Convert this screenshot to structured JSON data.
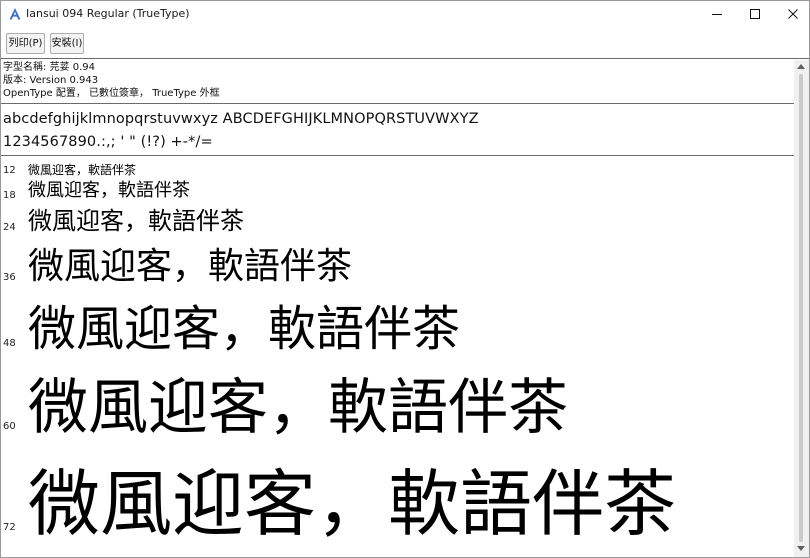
{
  "window": {
    "title": "Iansui 094 Regular (TrueType)",
    "controls": {
      "minimize": "minimize",
      "maximize": "maximize",
      "close": "close"
    }
  },
  "toolbar": {
    "print_label": "列印(P)",
    "install_label": "安裝(I)"
  },
  "font_info": {
    "name_line": "字型名稱: 芫荽 0.94",
    "version_line": "版本: Version 0.943",
    "features_line": "OpenType 配置， 已數位簽章， TrueType 外框"
  },
  "charset": {
    "alphabet": "abcdefghijklmnopqrstuvwxyz ABCDEFGHIJKLMNOPQRSTUVWXYZ",
    "digits_symbols": "1234567890.:,; ' \" (!?) +-*/="
  },
  "samples": [
    {
      "size_label": "12",
      "text": "微風迎客，軟語伴茶"
    },
    {
      "size_label": "18",
      "text": "微風迎客，軟語伴茶"
    },
    {
      "size_label": "24",
      "text": "微風迎客，軟語伴茶"
    },
    {
      "size_label": "36",
      "text": "微風迎客，軟語伴茶"
    },
    {
      "size_label": "48",
      "text": "微風迎客，軟語伴茶"
    },
    {
      "size_label": "60",
      "text": "微風迎客，軟語伴茶"
    },
    {
      "size_label": "72",
      "text": "微風迎客，軟語伴茶"
    }
  ],
  "icons": {
    "app": "font-viewer-icon",
    "scroll_up": "scroll-up-arrow-icon",
    "scroll_down": "scroll-down-arrow-icon"
  },
  "colors": {
    "app_icon_blue": "#3b6fd8",
    "divider": "#6b6b6b",
    "button_face": "#f3f3f3"
  }
}
